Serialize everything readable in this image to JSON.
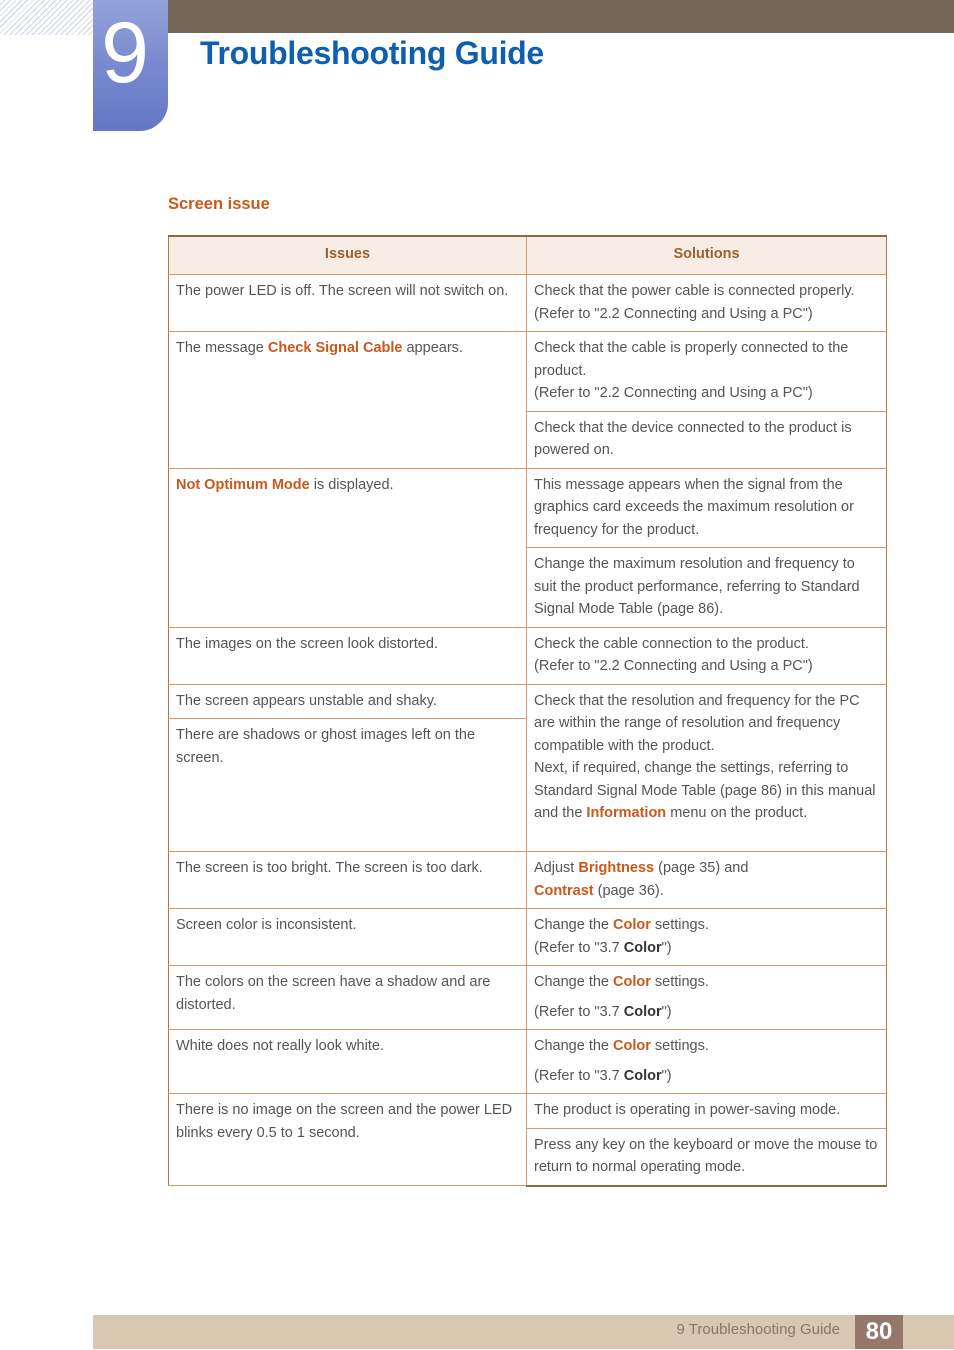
{
  "header": {
    "chapter_number": "9",
    "title": "Troubleshooting Guide",
    "colors": {
      "band": "#75685a",
      "tab": "#7889cf",
      "title": "#0e5fb0"
    }
  },
  "section": {
    "title": "Screen issue",
    "color": "#c8591b"
  },
  "table": {
    "headers": {
      "issues": "Issues",
      "solutions": "Solutions"
    },
    "rows": [
      {
        "issue": {
          "text": "The power LED is off. The screen will not switch on."
        },
        "solutions": [
          {
            "lines": [
              "Check that the power cable is connected properly.",
              "(Refer to \"2.2 Connecting and Using a PC\")"
            ]
          }
        ]
      },
      {
        "issue": {
          "pre": "The message ",
          "hl": "Check Signal Cable",
          "post": " appears."
        },
        "solutions": [
          {
            "lines": [
              "Check that the cable is properly connected to the product.",
              "(Refer to \"2.2 Connecting and Using a PC\")"
            ]
          },
          {
            "lines": [
              "Check that the device connected to the product is powered on."
            ]
          }
        ]
      },
      {
        "issue": {
          "pre": "",
          "hl": "Not Optimum Mode",
          "post": " is displayed."
        },
        "solutions": [
          {
            "lines": [
              "This message appears when the signal from the graphics card exceeds the maximum resolution or frequency for the product."
            ]
          },
          {
            "lines": [
              "Change the maximum resolution and frequency to suit the product performance, referring to Standard Signal Mode Table (page 86)."
            ]
          }
        ]
      },
      {
        "issue": {
          "text": "The images on the screen look distorted."
        },
        "solutions": [
          {
            "lines": [
              "Check the cable connection to the product.",
              "(Refer to \"2.2 Connecting and Using a PC\")"
            ]
          }
        ]
      },
      {
        "issue_a": "The screen appears unstable and shaky.",
        "issue_b": "There are shadows or ghost images left on the screen.",
        "solution": {
          "line1": "Check that the resolution and frequency for the PC are within the range of resolution and frequency compatible with the product.",
          "line2_pre": "Next, if required, change the settings, referring to Standard Signal Mode Table (page 86) in this manual and the ",
          "line2_hl": "Information",
          "line2_post": " menu on the product."
        }
      },
      {
        "issue": {
          "text": "The screen is too bright. The screen is too dark."
        },
        "solution": {
          "pre": "Adjust ",
          "hl1": "Brightness",
          "mid": " (page 35) and",
          "hl2": "Contrast",
          "post": " (page 36)."
        }
      },
      {
        "issue": {
          "text": "Screen color is inconsistent."
        },
        "solution": {
          "pre": "Change the ",
          "hl": "Color",
          "post": " settings.",
          "ref_pre": "(Refer to \"3.7 ",
          "ref_bold": "Color",
          "ref_post": "\")"
        }
      },
      {
        "issue": {
          "text": "The colors on the screen have a shadow and are distorted."
        },
        "solution": {
          "pre": "Change the ",
          "hl": "Color",
          "post": " settings.",
          "ref_pre": "(Refer to \"3.7 ",
          "ref_bold": "Color",
          "ref_post": "\")"
        }
      },
      {
        "issue": {
          "text": "White does not really look white."
        },
        "solution": {
          "pre": "Change the ",
          "hl": "Color",
          "post": " settings.",
          "ref_pre": "(Refer to \"3.7 ",
          "ref_bold": "Color",
          "ref_post": "\")"
        }
      },
      {
        "issue": {
          "text": "There is no image on the screen and the power LED blinks every 0.5 to 1 second."
        },
        "solutions": [
          {
            "lines": [
              "The product is operating in power-saving mode."
            ]
          },
          {
            "lines": [
              "Press any key on the keyboard or move the mouse to return to normal operating mode."
            ]
          }
        ]
      }
    ]
  },
  "footer": {
    "label": "9 Troubleshooting Guide",
    "page_number": "80"
  }
}
